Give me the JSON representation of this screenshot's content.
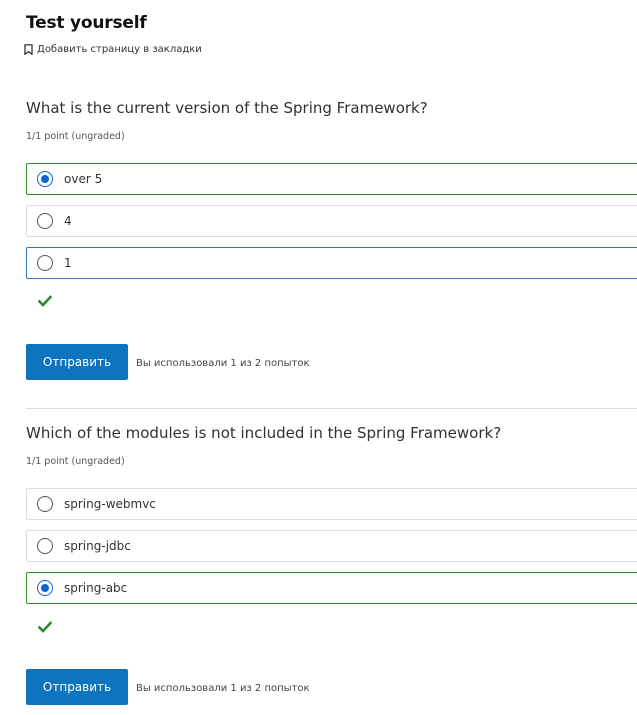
{
  "page": {
    "title": "Test yourself",
    "bookmark_label": "Добавить страницу в закладки",
    "bookmark_icon": "bookmark-icon"
  },
  "questions": [
    {
      "text": "What is the current version of the Spring Framework?",
      "points": "1/1 point (ungraded)",
      "options": [
        {
          "label": "over 5",
          "selected": true
        },
        {
          "label": "4",
          "selected": false
        },
        {
          "label": "1",
          "selected": false
        }
      ],
      "result_icon": "checkmark-icon",
      "submit_label": "Отправить",
      "attempts_text": "Вы использовали 1 из 2 попыток"
    },
    {
      "text": "Which of the modules is not included in the Spring Framework?",
      "points": "1/1 point (ungraded)",
      "options": [
        {
          "label": "spring-webmvc",
          "selected": false
        },
        {
          "label": "spring-jdbc",
          "selected": false
        },
        {
          "label": "spring-abc",
          "selected": true
        }
      ],
      "result_icon": "checkmark-icon",
      "submit_label": "Отправить",
      "attempts_text": "Вы использовали 1 из 2 попыток"
    }
  ],
  "colors": {
    "accent": "#0d74bd",
    "correct": "#2e8a2e",
    "radio_checked": "#0a66d3",
    "focus_border": "#2f74b5"
  }
}
